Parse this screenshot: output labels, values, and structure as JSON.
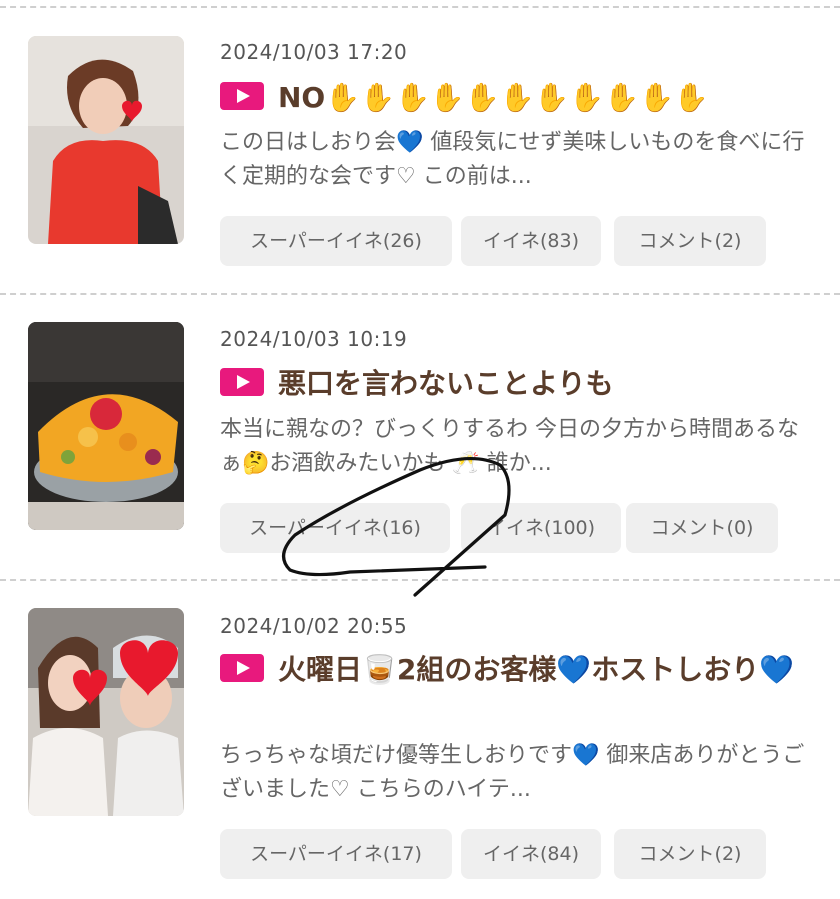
{
  "posts": [
    {
      "date": "2024/10/03 17:20",
      "title": "NO✋✋✋✋✋✋✋✋✋✋✋",
      "excerpt": "この日はしおり会💙 値段気にせず美味しいものを食べに行く定期的な会です♡ この前は...",
      "super_like": "スーパーイイネ(26)",
      "like": "イイネ(83)",
      "comment": "コメント(2)"
    },
    {
      "date": "2024/10/03 10:19",
      "title": "悪口を言わないことよりも",
      "excerpt": "本当に親なの？びっくりするわ 今日の夕方から時間あるなぁ🤔お酒飲みたいかも 🥂 誰か...",
      "super_like": "スーパーイイネ(16)",
      "like": "イイネ(100)",
      "comment": "コメント(0)"
    },
    {
      "date": "2024/10/02 20:55",
      "title": "火曜日🥃2組のお客様💙ホストしおり💙",
      "excerpt": "ちっちゃな頃だけ優等生しおりです💙 御来店ありがとうございました♡ こちらのハイテ...",
      "super_like": "スーパーイイネ(17)",
      "like": "イイネ(84)",
      "comment": "コメント(2)"
    }
  ],
  "colors": {
    "badge": "#e8197d",
    "title": "#5a3d2b",
    "button_bg": "#efefef"
  },
  "icons": [
    "play-badge-icon",
    "heart-sticker-icon"
  ]
}
